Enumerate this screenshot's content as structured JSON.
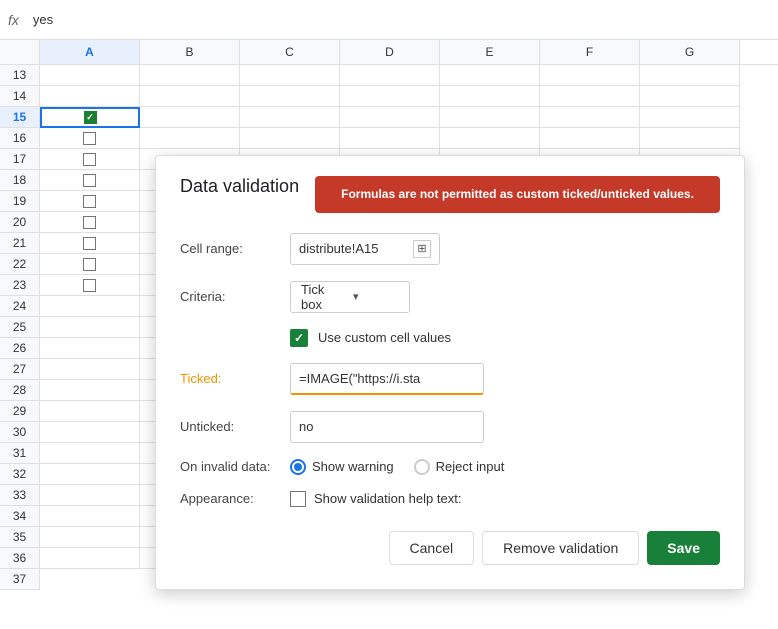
{
  "formula_bar": {
    "fx_label": "fx",
    "cell_value": "yes"
  },
  "columns": [
    "A",
    "B",
    "C",
    "D",
    "E",
    "F",
    "G"
  ],
  "rows": [
    13,
    14,
    15,
    16,
    17,
    18,
    19,
    20,
    21,
    22,
    23,
    24,
    25,
    26,
    27,
    28,
    29,
    30,
    31,
    32,
    33,
    34,
    35,
    36,
    37
  ],
  "active_cell": "A15",
  "checked_rows": [
    15
  ],
  "unchecked_rows": [
    16,
    17,
    18,
    19,
    20,
    21,
    22,
    23
  ],
  "dialog": {
    "title": "Data validation",
    "error_banner": "Formulas are not permitted as custom ticked/unticked values.",
    "cell_range_label": "Cell range:",
    "cell_range_value": "distribute!A15",
    "criteria_label": "Criteria:",
    "criteria_value": "Tick box",
    "custom_values_label": "Use custom cell values",
    "ticked_label": "Ticked:",
    "ticked_value": "=IMAGE(\"https://i.sta",
    "unticked_label": "Unticked:",
    "unticked_value": "no",
    "on_invalid_label": "On invalid data:",
    "show_warning_label": "Show warning",
    "reject_input_label": "Reject input",
    "appearance_label": "Appearance:",
    "validation_help_label": "Show validation help text:",
    "cancel_label": "Cancel",
    "remove_validation_label": "Remove validation",
    "save_label": "Save"
  }
}
